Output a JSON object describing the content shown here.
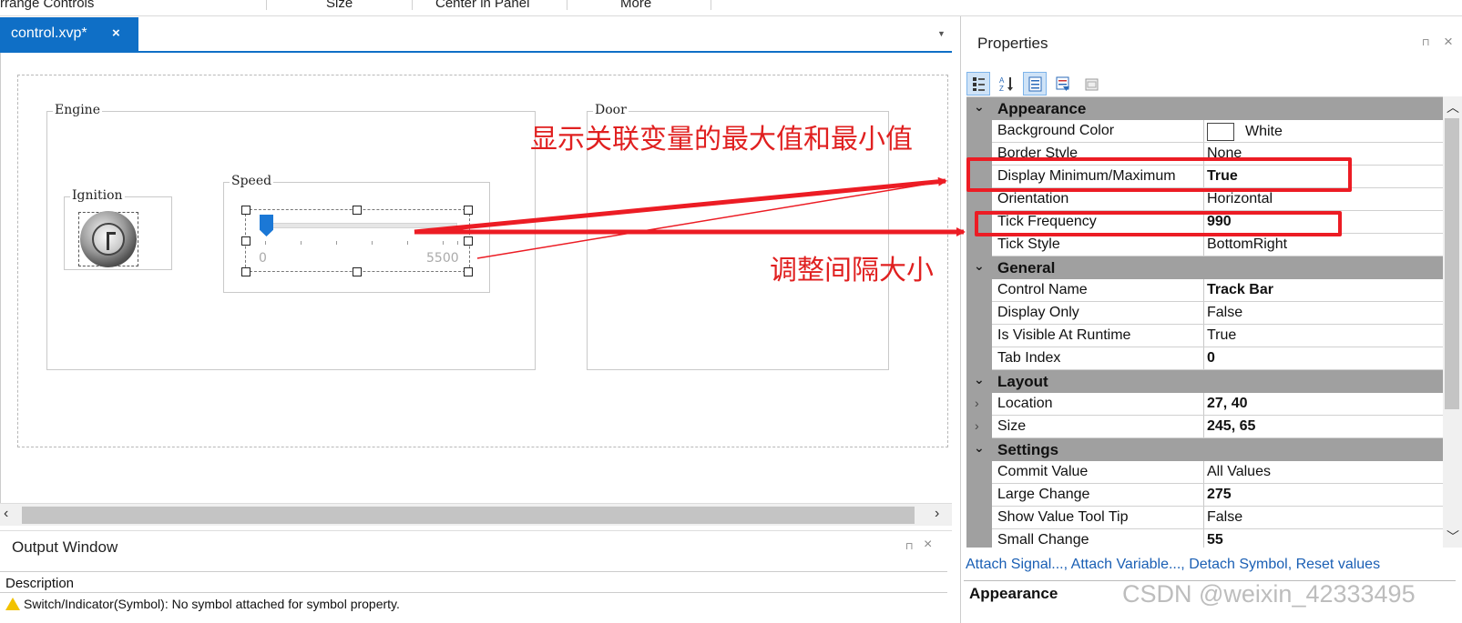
{
  "ribbon": {
    "items": [
      "rrange Controls",
      "Size",
      "Center in Panel",
      "More"
    ]
  },
  "tabs": {
    "document_tab": "control.xvp*",
    "close_glyph": "×",
    "dropdown_glyph": "▼"
  },
  "canvas": {
    "groups": {
      "engine": "Engine",
      "door": "Door",
      "ignition": "Ignition",
      "speed": "Speed"
    },
    "trackbar": {
      "min_label": "0",
      "max_label": "5500",
      "value_fraction": 0.0
    }
  },
  "output_window": {
    "title": "Output Window",
    "pin_glyph": "⊓",
    "close_glyph": "×",
    "column_header": "Description",
    "rows": [
      "Switch/Indicator(Symbol): No symbol attached for symbol property."
    ]
  },
  "properties": {
    "title": "Properties",
    "pin_glyph": "⊓",
    "close_glyph": "×",
    "toolbar_icons": [
      "categorized-icon",
      "alphabetical-icon",
      "properties-page-icon",
      "events-icon",
      "property-pages-icon"
    ],
    "categories": [
      {
        "name": "Appearance",
        "rows": [
          {
            "name": "Background Color",
            "value": "White",
            "bold": false,
            "swatch": "#ffffff"
          },
          {
            "name": "Border Style",
            "value": "None",
            "bold": false
          },
          {
            "name": "Display Minimum/Maximum",
            "value": "True",
            "bold": true
          },
          {
            "name": "Orientation",
            "value": "Horizontal",
            "bold": false
          },
          {
            "name": "Tick Frequency",
            "value": "990",
            "bold": true
          },
          {
            "name": "Tick Style",
            "value": "BottomRight",
            "bold": false
          }
        ]
      },
      {
        "name": "General",
        "rows": [
          {
            "name": "Control Name",
            "value": "Track Bar",
            "bold": true
          },
          {
            "name": "Display Only",
            "value": "False",
            "bold": false
          },
          {
            "name": "Is Visible At Runtime",
            "value": "True",
            "bold": false
          },
          {
            "name": "Tab Index",
            "value": "0",
            "bold": true
          }
        ]
      },
      {
        "name": "Layout",
        "rows": [
          {
            "name": "Location",
            "value": "27, 40",
            "bold": true,
            "expandable": true
          },
          {
            "name": "Size",
            "value": "245, 65",
            "bold": true,
            "expandable": true
          }
        ]
      },
      {
        "name": "Settings",
        "rows": [
          {
            "name": "Commit Value",
            "value": "All Values",
            "bold": false
          },
          {
            "name": "Large Change",
            "value": "275",
            "bold": true
          },
          {
            "name": "Show Value Tool Tip",
            "value": "False",
            "bold": false
          },
          {
            "name": "Small Change",
            "value": "55",
            "bold": true
          }
        ]
      }
    ],
    "links": [
      "Attach Signal...",
      "Attach Variable...",
      "Detach Symbol",
      "Reset values"
    ],
    "description_title": "Appearance"
  },
  "annotations": {
    "minmax_note": "显示关联变量的最大值和最小值",
    "tick_note": "调整间隔大小",
    "color": "#ec1c24"
  },
  "watermark": "CSDN @weixin_42333495",
  "colors": {
    "accent": "#0f6fc6",
    "category_bg": "#a0a0a0",
    "link": "#1a5fb4"
  }
}
